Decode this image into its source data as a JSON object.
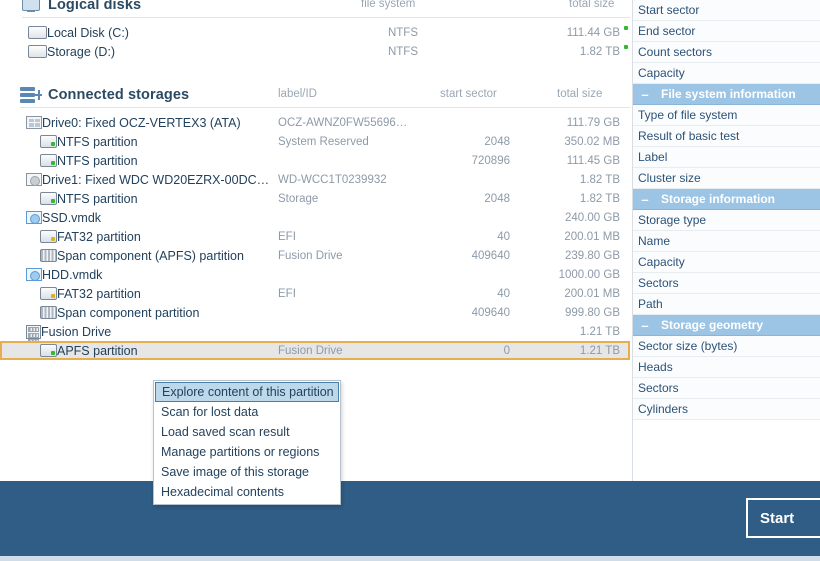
{
  "logical_disks": {
    "title": "Logical disks",
    "icon": "monitor-icon",
    "columns": {
      "file_system": "file system",
      "total_size": "total size"
    },
    "rows": [
      {
        "name": "Local Disk (C:)",
        "file_system": "NTFS",
        "total_size": "111.44 GB",
        "icon": "logical-disk-icon"
      },
      {
        "name": "Storage (D:)",
        "file_system": "NTFS",
        "total_size": "1.82 TB",
        "icon": "logical-disk-icon"
      }
    ]
  },
  "connected_storages": {
    "title": "Connected storages",
    "icon": "storage-stack-icon",
    "columns": {
      "label_id": "label/ID",
      "start_sector": "start sector",
      "total_size": "total size"
    },
    "rows": [
      {
        "name": "Drive0: Fixed OCZ-VERTEX3 (ATA)",
        "label": "OCZ-AWNZ0FW55696…",
        "start": "",
        "size": "111.79 GB",
        "indent": 0,
        "icon": "drive-grid-icon",
        "selected": false
      },
      {
        "name": "NTFS partition",
        "label": "System Reserved",
        "start": "2048",
        "size": "350.02 MB",
        "indent": 1,
        "icon": "partition-icon",
        "selected": false
      },
      {
        "name": "NTFS partition",
        "label": "",
        "start": "720896",
        "size": "111.45 GB",
        "indent": 1,
        "icon": "partition-icon",
        "selected": false
      },
      {
        "name": "Drive1: Fixed WDC WD20EZRX-00DC…",
        "label": "WD-WCC1T0239932",
        "start": "",
        "size": "1.82 TB",
        "indent": 0,
        "icon": "drive-platter-icon",
        "selected": false
      },
      {
        "name": "NTFS partition",
        "label": "Storage",
        "start": "2048",
        "size": "1.82 TB",
        "indent": 1,
        "icon": "partition-icon",
        "selected": false
      },
      {
        "name": "SSD.vmdk",
        "label": "",
        "start": "",
        "size": "240.00 GB",
        "indent": 0,
        "icon": "disk-image-icon",
        "selected": false
      },
      {
        "name": "FAT32 partition",
        "label": "EFI",
        "start": "40",
        "size": "200.01 MB",
        "indent": 1,
        "icon": "partition-amber-icon",
        "selected": false
      },
      {
        "name": "Span component (APFS) partition",
        "label": "Fusion Drive",
        "start": "409640",
        "size": "239.80 GB",
        "indent": 1,
        "icon": "span-component-icon",
        "selected": false
      },
      {
        "name": "HDD.vmdk",
        "label": "",
        "start": "",
        "size": "1000.00 GB",
        "indent": 0,
        "icon": "disk-image-icon",
        "selected": false
      },
      {
        "name": "FAT32 partition",
        "label": "EFI",
        "start": "40",
        "size": "200.01 MB",
        "indent": 1,
        "icon": "partition-amber-icon",
        "selected": false
      },
      {
        "name": "Span component partition",
        "label": "",
        "start": "409640",
        "size": "999.80 GB",
        "indent": 1,
        "icon": "span-component-icon",
        "selected": false
      },
      {
        "name": "Fusion Drive",
        "label": "",
        "start": "",
        "size": "1.21 TB",
        "indent": 0,
        "icon": "fusion-drive-icon",
        "selected": false
      },
      {
        "name": "APFS partition",
        "label": "Fusion Drive",
        "start": "0",
        "size": "1.21 TB",
        "indent": 1,
        "icon": "partition-icon",
        "selected": true
      }
    ]
  },
  "context_menu": {
    "items": [
      {
        "label": "Explore content of this partition",
        "active": true
      },
      {
        "label": "Scan for lost data",
        "active": false
      },
      {
        "label": "Load saved scan result",
        "active": false
      },
      {
        "label": "Manage partitions or regions",
        "active": false
      },
      {
        "label": "Save image of this storage",
        "active": false
      },
      {
        "label": "Hexadecimal contents",
        "active": false
      }
    ]
  },
  "sidebar": {
    "rows": [
      {
        "type": "field",
        "label": "Start sector"
      },
      {
        "type": "field",
        "label": "End sector"
      },
      {
        "type": "field",
        "label": "Count sectors"
      },
      {
        "type": "field",
        "label": "Capacity"
      },
      {
        "type": "section",
        "label": "File system information",
        "collapse": "–"
      },
      {
        "type": "field",
        "label": "Type of file system"
      },
      {
        "type": "field",
        "label": "Result of basic test"
      },
      {
        "type": "field",
        "label": "Label"
      },
      {
        "type": "field",
        "label": "Cluster size"
      },
      {
        "type": "section",
        "label": "Storage information",
        "collapse": "–"
      },
      {
        "type": "field",
        "label": "Storage type"
      },
      {
        "type": "field",
        "label": "Name"
      },
      {
        "type": "field",
        "label": "Capacity"
      },
      {
        "type": "field",
        "label": "Sectors"
      },
      {
        "type": "field",
        "label": "Path"
      },
      {
        "type": "section",
        "label": "Storage geometry",
        "collapse": "–"
      },
      {
        "type": "field",
        "label": "Sector size (bytes)"
      },
      {
        "type": "field",
        "label": "Heads"
      },
      {
        "type": "field",
        "label": "Sectors"
      },
      {
        "type": "field",
        "label": "Cylinders"
      }
    ]
  },
  "bottom_bar": {
    "start_button_label": "Start"
  },
  "colors": {
    "accent_blue": "#2f5d86",
    "section_header": "#9cc4e4",
    "selection_border": "#e6ae4e",
    "menu_highlight": "#bcd8ea"
  }
}
